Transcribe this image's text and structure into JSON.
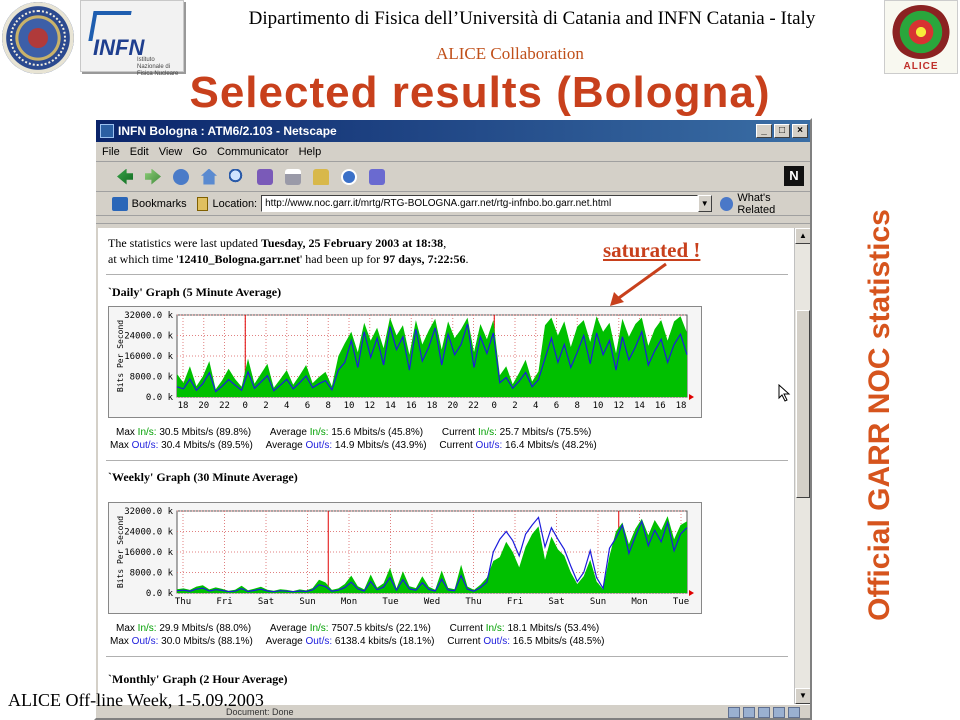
{
  "header": {
    "department": "Dipartimento di Fisica dell’Università di Catania and INFN Catania - Italy",
    "collaboration": "ALICE Collaboration",
    "title": "Selected results (Bologna)",
    "vertical_title": "Official GARR NOC statistics",
    "footer": "ALICE Off-line Week, 1-5.09.2003",
    "logos": {
      "infn": "INFN",
      "infn_sub": "Istituto Nazionale di Fisica Nucleare",
      "alice": "ALICE"
    }
  },
  "annotation": {
    "label": "saturated !",
    "color": "#c8401c"
  },
  "browser": {
    "window_title": "INFN Bologna : ATM6/2.103 - Netscape",
    "menu": [
      "File",
      "Edit",
      "View",
      "Go",
      "Communicator",
      "Help"
    ],
    "toolbar_icons": [
      "back-icon",
      "forward-icon",
      "reload-icon",
      "home-icon",
      "search-icon",
      "netscape-icon",
      "print-icon",
      "security-icon",
      "shop-icon",
      "stop-icon"
    ],
    "bookmarks_label": "Bookmarks",
    "location_label": "Location:",
    "url": "http://www.noc.garr.it/mrtg/RTG-BOLOGNA.garr.net/rtg-infnbo.bo.garr.net.html",
    "related_label": "What's Related",
    "status_text": "Document: Done"
  },
  "page": {
    "intro_1": "The statistics were last updated ",
    "updated": "Tuesday, 25 February 2003 at 18:38",
    "intro_2": ",",
    "intro_3": "at which time '",
    "host": "12410_Bologna.garr.net",
    "intro_4": "' had been up for ",
    "uptime": "97 days, 7:22:56",
    "intro_5": ".",
    "daily": {
      "heading": "`Daily' Graph (5 Minute Average)",
      "stats_in": [
        "Max ",
        "In/s:",
        " 30.5 Mbits/s (89.8%)",
        "Average ",
        "In/s:",
        " 15.6 Mbits/s (45.8%)",
        "Current ",
        "In/s:",
        " 25.7 Mbits/s (75.5%)"
      ],
      "stats_out": [
        "Max ",
        "Out/s:",
        " 30.4 Mbits/s (89.5%)",
        "Average ",
        "Out/s:",
        " 14.9 Mbits/s (43.9%)",
        "Current ",
        "Out/s:",
        " 16.4 Mbits/s (48.2%)"
      ]
    },
    "weekly": {
      "heading": "`Weekly' Graph (30 Minute Average)",
      "stats_in": [
        "Max ",
        "In/s:",
        " 29.9 Mbits/s (88.0%)",
        "Average ",
        "In/s:",
        " 7507.5 kbits/s (22.1%)",
        "Current ",
        "In/s:",
        " 18.1 Mbits/s (53.4%)"
      ],
      "stats_out": [
        "Max ",
        "Out/s:",
        " 30.0 Mbits/s (88.1%)",
        "Average ",
        "Out/s:",
        " 6138.4 kbits/s (18.1%)",
        "Current ",
        "Out/s:",
        " 16.5 Mbits/s (48.5%)"
      ]
    },
    "monthly": {
      "heading": "`Monthly' Graph (2 Hour Average)"
    }
  },
  "chart_data": [
    {
      "type": "area",
      "title": "`Daily' Graph (5 Minute Average)",
      "ylabel": "Bits Per Second",
      "y_ticks": [
        "32000.0 k",
        "24000.0 k",
        "16000.0 k",
        "8000.0 k",
        "0.0 k"
      ],
      "ylim": [
        0,
        32000
      ],
      "x_ticks": [
        "18",
        "20",
        "22",
        "0",
        "2",
        "4",
        "6",
        "8",
        "10",
        "12",
        "14",
        "16",
        "18",
        "20",
        "22",
        "0",
        "2",
        "4",
        "6",
        "8",
        "10",
        "12",
        "14",
        "16",
        "18"
      ],
      "day_markers_at_tick": [
        3,
        15
      ],
      "series": [
        {
          "name": "In/s",
          "color": "#00c000",
          "values": [
            9000,
            5500,
            12000,
            4200,
            8000,
            14000,
            3000,
            6500,
            11000,
            7000,
            4000,
            15000,
            5200,
            9000,
            13000,
            3600,
            7000,
            10500,
            4800,
            8500,
            12500,
            5400,
            7800,
            9800,
            4200,
            16000,
            21000,
            25500,
            17500,
            29000,
            22000,
            27000,
            19000,
            31000,
            24000,
            28000,
            16500,
            30000,
            20500,
            26000,
            30500,
            18500,
            29500,
            23000,
            26500,
            31000,
            17500,
            28500,
            22500,
            30000,
            8500,
            12000,
            5000,
            9500,
            14500,
            6000,
            10000,
            28000,
            31000,
            24000,
            29500,
            19500,
            27500,
            30000,
            21500,
            31500,
            25500,
            29000,
            17000,
            30500,
            23500,
            28500,
            31000,
            20000,
            26500,
            30000,
            22000,
            29500,
            31500,
            25000
          ]
        },
        {
          "name": "Out/s",
          "color": "#1c1cdc",
          "values": [
            4000,
            3200,
            7000,
            2600,
            5200,
            9500,
            2100,
            4200,
            6800,
            4600,
            2600,
            9800,
            3400,
            5800,
            8300,
            2400,
            4600,
            6900,
            3200,
            5600,
            8200,
            3600,
            5200,
            6400,
            2800,
            10500,
            13500,
            22000,
            11500,
            25500,
            15500,
            23000,
            12500,
            27500,
            18500,
            23500,
            10500,
            26500,
            14000,
            19500,
            27000,
            12500,
            24500,
            16500,
            20500,
            28500,
            11500,
            23500,
            17000,
            25000,
            5600,
            7600,
            3400,
            6200,
            9600,
            4000,
            6800,
            15000,
            23000,
            13500,
            20500,
            11500,
            17500,
            24000,
            13000,
            25000,
            16500,
            22000,
            10500,
            23500,
            14500,
            19500,
            25500,
            12500,
            18000,
            22500,
            13500,
            20500,
            24500,
            16500
          ]
        }
      ]
    },
    {
      "type": "area",
      "title": "`Weekly' Graph (30 Minute Average)",
      "ylabel": "Bits Per Second",
      "y_ticks": [
        "32000.0 k",
        "24000.0 k",
        "16000.0 k",
        "8000.0 k",
        "0.0 k"
      ],
      "ylim": [
        0,
        32000
      ],
      "x_ticks": [
        "Thu",
        "Fri",
        "Sat",
        "Sun",
        "Mon",
        "Tue",
        "Wed",
        "Thu",
        "Fri",
        "Sat",
        "Sun",
        "Mon",
        "Tue"
      ],
      "week_markers_at_tick": [
        3.5,
        10.5
      ],
      "series": [
        {
          "name": "In/s",
          "color": "#00c000",
          "values": [
            1500,
            1800,
            1200,
            2500,
            3000,
            1400,
            2200,
            1600,
            900,
            1300,
            2800,
            1100,
            1700,
            2400,
            1300,
            900,
            1500,
            1200,
            800,
            1400,
            1000,
            1900,
            5200,
            4100,
            1200,
            1800,
            3500,
            6800,
            2600,
            1400,
            7200,
            2100,
            3800,
            9800,
            1800,
            8500,
            2600,
            1900,
            6500,
            2400,
            1300,
            8800,
            2000,
            1500,
            11000,
            2500,
            1200,
            3200,
            6000,
            12500,
            14000,
            20000,
            16000,
            10000,
            18000,
            23000,
            26000,
            13000,
            22000,
            17000,
            14500,
            8000,
            3500,
            6500,
            13000,
            4500,
            1400,
            14500,
            24000,
            27500,
            19000,
            25000,
            29000,
            22500,
            28500,
            24500,
            30000,
            21000,
            26500,
            28000
          ]
        },
        {
          "name": "Out/s",
          "color": "#1c1cdc",
          "values": [
            900,
            1100,
            700,
            1500,
            1900,
            800,
            1300,
            1000,
            500,
            700,
            1700,
            600,
            1000,
            1500,
            800,
            500,
            900,
            700,
            500,
            800,
            600,
            1200,
            3200,
            2500,
            700,
            1100,
            2100,
            4200,
            1600,
            800,
            4500,
            1300,
            2300,
            6000,
            1100,
            5200,
            1600,
            1100,
            4000,
            1400,
            800,
            5400,
            1200,
            900,
            6800,
            1500,
            700,
            2100,
            4200,
            16000,
            21000,
            24000,
            20500,
            14500,
            23000,
            26500,
            29500,
            18000,
            25500,
            21000,
            17000,
            10500,
            4500,
            8000,
            16500,
            6000,
            1800,
            17500,
            21500,
            26500,
            15500,
            22000,
            28000,
            18500,
            24500,
            20000,
            27500,
            16500,
            23000,
            25500
          ]
        }
      ]
    }
  ]
}
